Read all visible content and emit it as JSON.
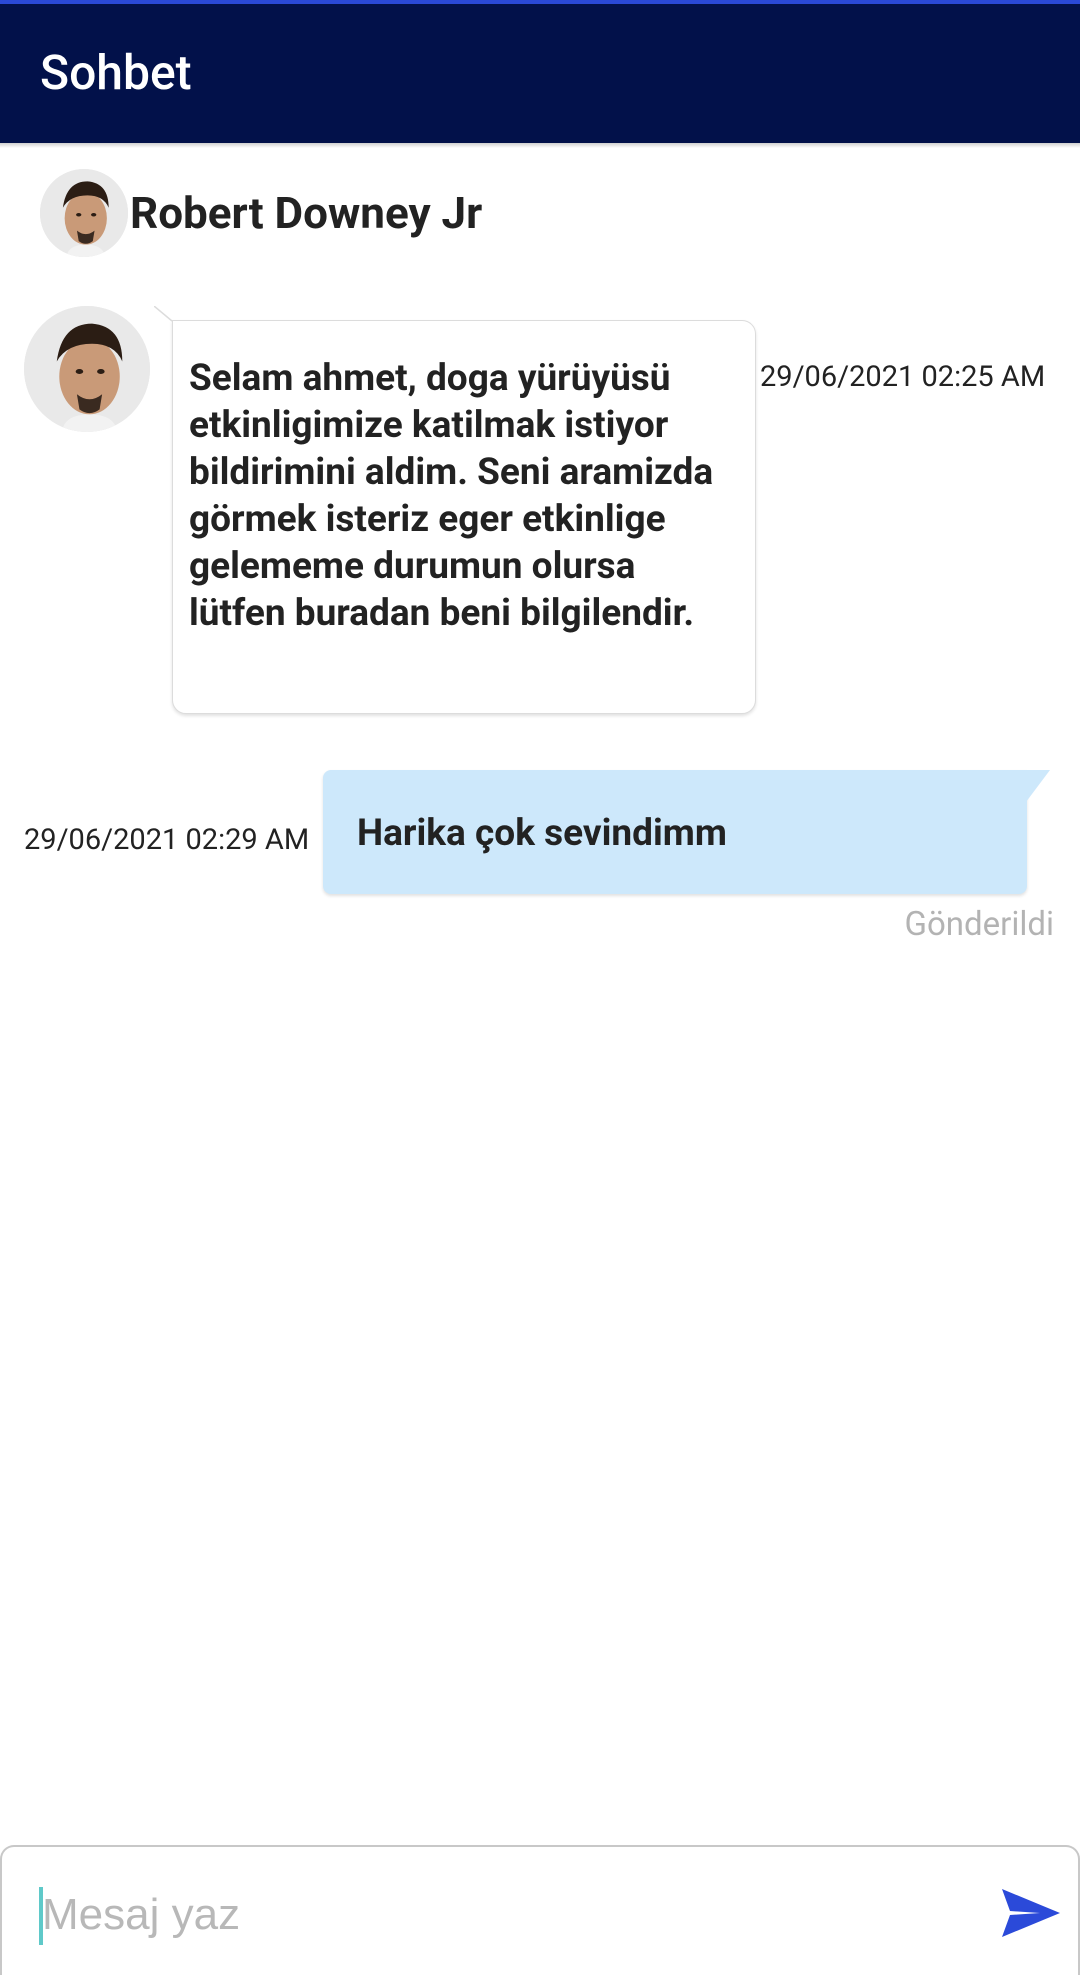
{
  "appbar": {
    "title": "Sohbet"
  },
  "contact": {
    "name": "Robert Downey Jr",
    "avatar_icon": "user-avatar-photo"
  },
  "messages": [
    {
      "direction": "incoming",
      "text": "Selam ahmet, doga yürüyüsü etkinligimize katilmak istiyor bildirimini aldim. Seni aramizda görmek isteriz eger etkinlige gelememe durumun olursa lütfen buradan beni bilgilendir.",
      "time": "29/06/2021 02:25 AM"
    },
    {
      "direction": "outgoing",
      "text": "Harika çok sevindimm",
      "time": "29/06/2021 02:29 AM",
      "status": "Gönderildi"
    }
  ],
  "composer": {
    "placeholder": "Mesaj yaz",
    "value": "",
    "send_icon": "send-icon"
  },
  "colors": {
    "appbar": "#02114a",
    "outgoing_bubble": "#cde8fb",
    "send_icon": "#2b4ad9",
    "status_text": "#b3b3b3"
  }
}
